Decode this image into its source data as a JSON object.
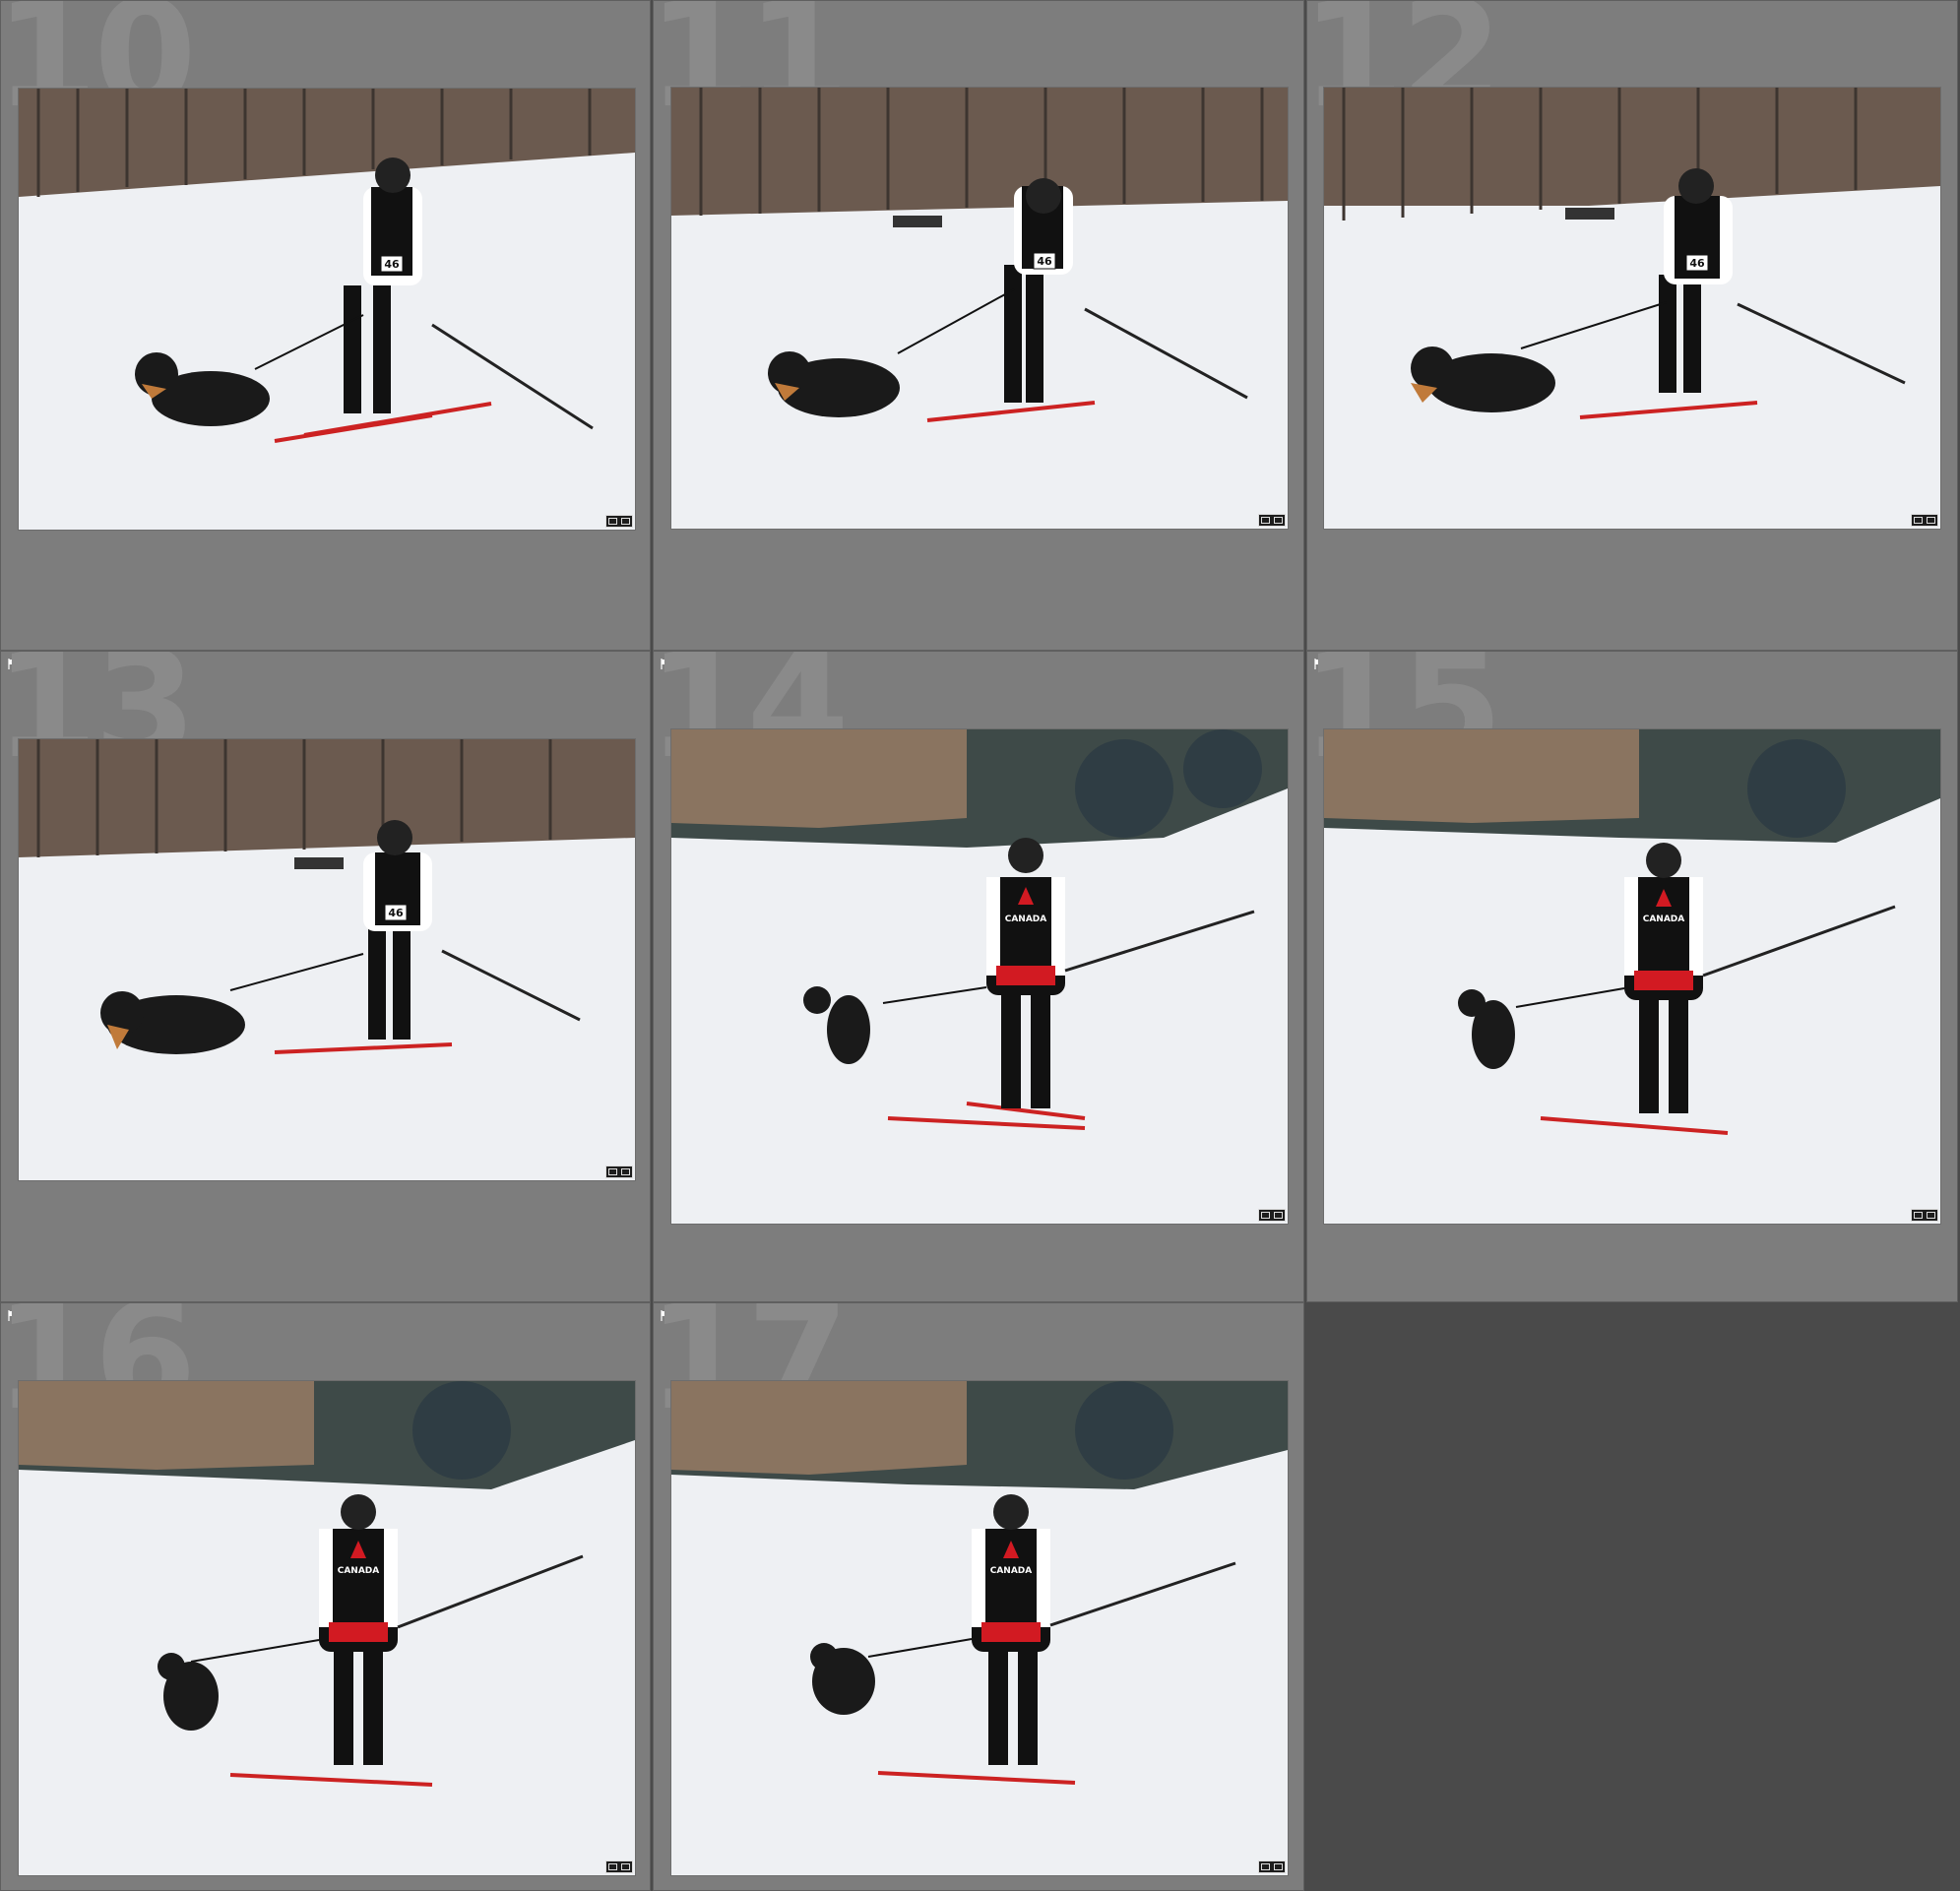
{
  "grid": {
    "cells": [
      {
        "number": "10",
        "flagged": false,
        "scene": "front"
      },
      {
        "number": "11",
        "flagged": false,
        "scene": "front"
      },
      {
        "number": "12",
        "flagged": false,
        "scene": "front"
      },
      {
        "number": "13",
        "flagged": true,
        "scene": "front"
      },
      {
        "number": "14",
        "flagged": true,
        "scene": "back"
      },
      {
        "number": "15",
        "flagged": true,
        "scene": "back"
      },
      {
        "number": "16",
        "flagged": true,
        "scene": "back"
      },
      {
        "number": "17",
        "flagged": true,
        "scene": "back"
      }
    ],
    "bib_text": "46",
    "jacket_text": "CANADA"
  },
  "colors": {
    "cell_bg": "#7d7d7d",
    "panel_bg": "#4a4a4a",
    "snow": "#eef0f3",
    "accent_red": "#d21a22"
  }
}
